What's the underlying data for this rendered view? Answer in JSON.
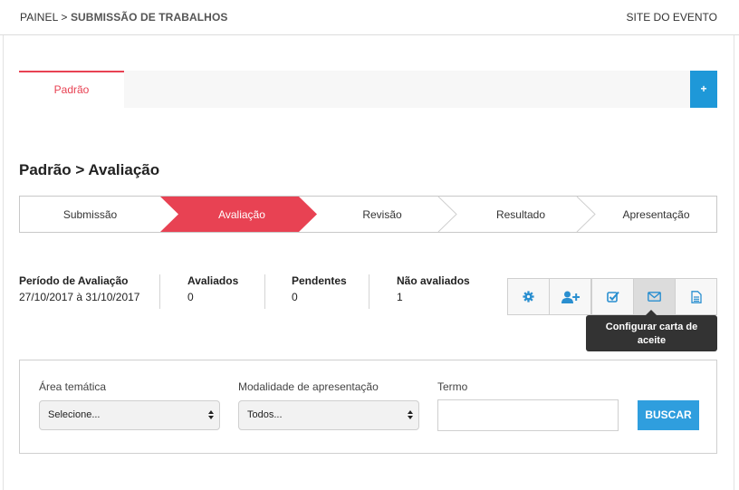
{
  "header": {
    "breadcrumb_root": "PAINEL >",
    "breadcrumb_current": "SUBMISSÃO DE TRABALHOS",
    "site_link": "SITE DO EVENTO"
  },
  "tabs": {
    "active_label": "Padrão",
    "add_label": "+"
  },
  "section_title": "Padrão > Avaliação",
  "steps": [
    {
      "label": "Submissão",
      "active": false
    },
    {
      "label": "Avaliação",
      "active": true
    },
    {
      "label": "Revisão",
      "active": false
    },
    {
      "label": "Resultado",
      "active": false
    },
    {
      "label": "Apresentação",
      "active": false
    }
  ],
  "stats": [
    {
      "title": "Período de Avaliação",
      "value": "27/10/2017 à 31/10/2017"
    },
    {
      "title": "Avaliados",
      "value": "0"
    },
    {
      "title": "Pendentes",
      "value": "0"
    },
    {
      "title": "Não avaliados",
      "value": "1"
    }
  ],
  "toolbar": {
    "icons": [
      "gear-icon",
      "add-user-icon",
      "checkbox-icon",
      "envelope-icon",
      "document-icon"
    ],
    "tooltip": "Configurar carta de aceite"
  },
  "filters": {
    "area_label": "Área temática",
    "area_value": "Selecione...",
    "modalidade_label": "Modalidade de apresentação",
    "modalidade_value": "Todos...",
    "termo_label": "Termo",
    "termo_value": "",
    "search_label": "BUSCAR"
  },
  "colors": {
    "accent_red": "#e84253",
    "accent_blue": "#1e98d8",
    "icon_blue": "#2a8fd0"
  }
}
